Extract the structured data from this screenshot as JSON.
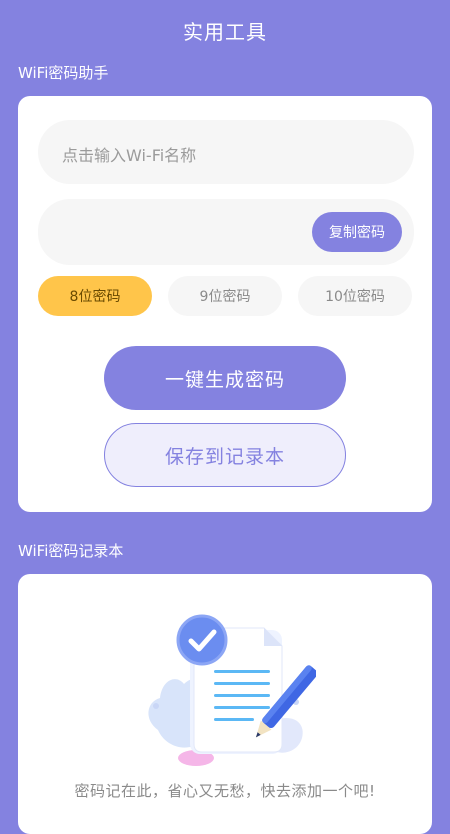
{
  "header": {
    "title": "实用工具"
  },
  "wifi_helper": {
    "section_title": "WiFi密码助手",
    "name_input": {
      "placeholder": "点击输入Wi-Fi名称",
      "value": ""
    },
    "password_field": {
      "value": ""
    },
    "copy_label": "复制密码",
    "length_options": [
      {
        "label": "8位密码",
        "selected": true
      },
      {
        "label": "9位密码",
        "selected": false
      },
      {
        "label": "10位密码",
        "selected": false
      }
    ],
    "generate_label": "一键生成密码",
    "save_label": "保存到记录本"
  },
  "record_book": {
    "section_title": "WiFi密码记录本",
    "illustration_icon": "document-pencil-check-icon",
    "empty_text": "密码记在此，省心又无愁，快去添加一个吧!"
  },
  "colors": {
    "background": "#8482E0",
    "accent": "#8482E0",
    "selected_option": "#FFC54A"
  }
}
